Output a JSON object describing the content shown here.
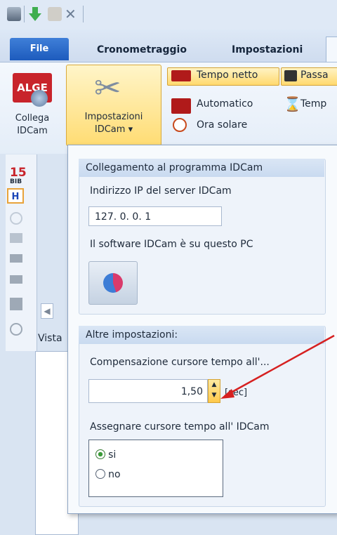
{
  "tabs": {
    "file": "File",
    "cronometraggio": "Cronometraggio",
    "impostazioni": "Impostazioni"
  },
  "ribbon": {
    "collega": [
      "Collega",
      "IDCam"
    ],
    "impostazioni_idcam": [
      "Impostazioni",
      "IDCam ▾"
    ],
    "tempo_netto": "Tempo netto",
    "automatico": "Automatico",
    "ora_solare": "Ora solare",
    "passa": "Passa",
    "temp": "Temp",
    "alge_logo": "ALGE"
  },
  "left_strip": {
    "bib_num": "15",
    "bib_label": "BIB"
  },
  "background": {
    "vista": "Vista"
  },
  "dropdown": {
    "group1_title": "Collegamento al programma IDCam",
    "ip_label": "Indirizzo IP del server IDCam",
    "ip_value": "127. 0. 0. 1",
    "software_label": "Il software IDCam è su questo PC",
    "group2_title": "Altre impostazioni:",
    "comp_label": "Compensazione cursore tempo all'...",
    "comp_value": "1,50",
    "comp_unit": "[sec]",
    "assign_label": "Assegnare cursore tempo all' IDCam",
    "radio_si": "si",
    "radio_no": "no",
    "radio_selected": "si"
  },
  "icons": [
    "key-icon",
    "download-icon",
    "hand-icon",
    "tools-icon",
    "sync-icon",
    "clock-icon",
    "hourglass-icon",
    "timer-icon",
    "auto-icon"
  ]
}
